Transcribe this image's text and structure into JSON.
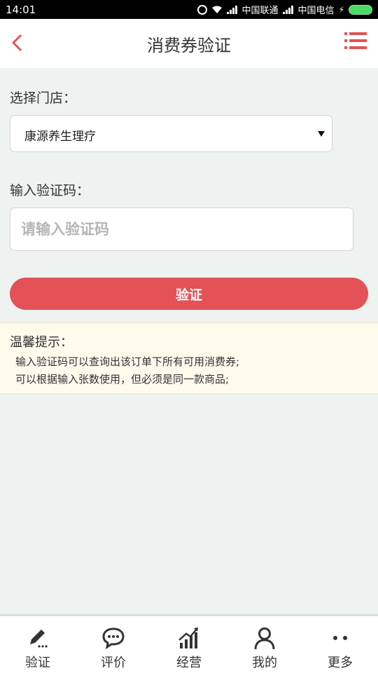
{
  "status_bar": {
    "time": "14:01",
    "carrier1": "中国联通",
    "carrier2": "中国电信"
  },
  "header": {
    "title": "消费券验证",
    "back_icon": "chevron-left-icon",
    "menu_icon": "list-menu-icon"
  },
  "colors": {
    "accent": "#e25256",
    "background": "#eef2f1",
    "tips_background": "#fefbed"
  },
  "form": {
    "store_label": "选择门店：",
    "store_selected": "康源养生理疗",
    "code_label": "输入验证码：",
    "code_placeholder": "请输入验证码",
    "code_value": "",
    "verify_label": "验证"
  },
  "tips": {
    "title": "温馨提示：",
    "lines": [
      "输入验证码可以查询出该订单下所有可用消费券;",
      "可以根据输入张数使用，但必须是同一款商品;"
    ]
  },
  "bottom_nav": [
    {
      "label": "验证",
      "icon": "pencil-icon"
    },
    {
      "label": "评价",
      "icon": "chat-bubble-icon"
    },
    {
      "label": "经营",
      "icon": "bar-chart-icon"
    },
    {
      "label": "我的",
      "icon": "user-icon"
    },
    {
      "label": "更多",
      "icon": "more-dots-icon"
    }
  ]
}
